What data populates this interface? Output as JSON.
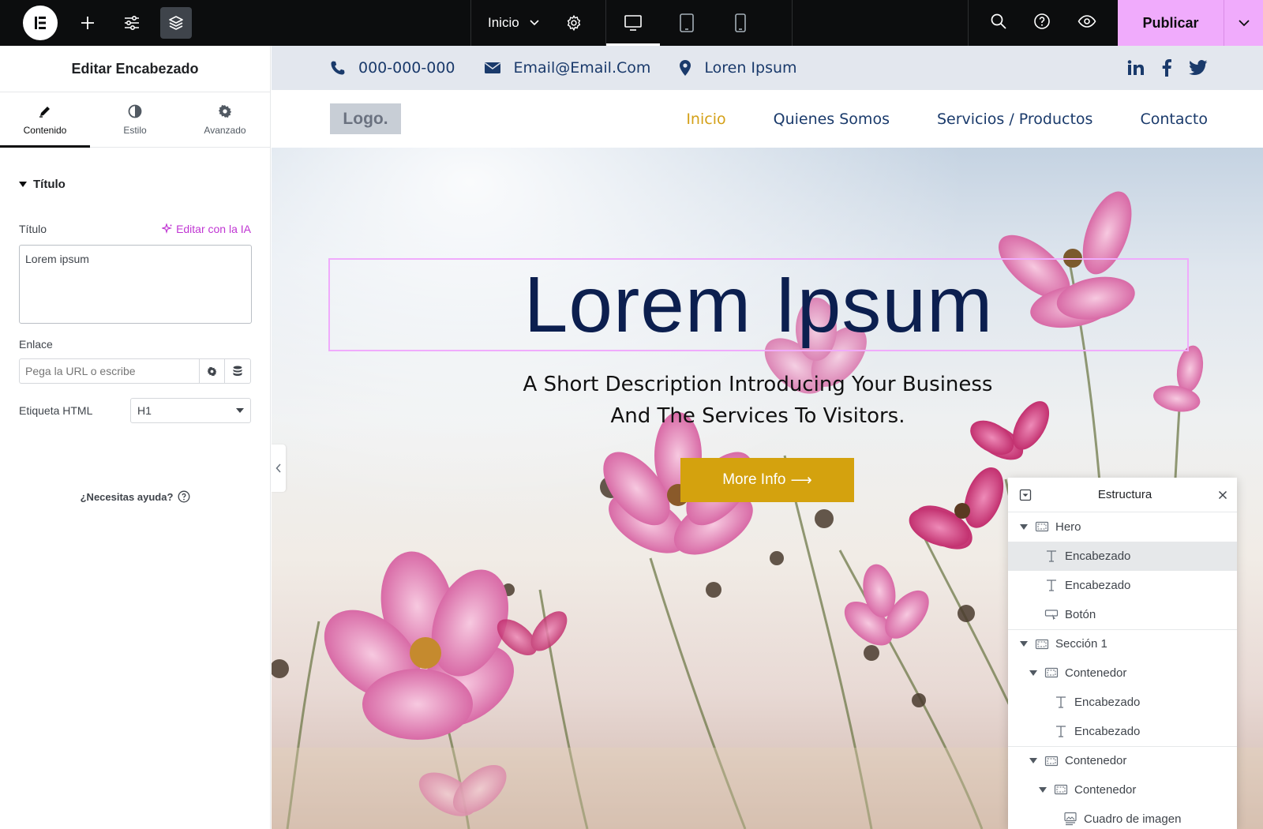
{
  "topbar": {
    "page_label": "Inicio",
    "publish_label": "Publicar"
  },
  "panel": {
    "title": "Editar Encabezado",
    "tabs": [
      {
        "label": "Contenido"
      },
      {
        "label": "Estilo"
      },
      {
        "label": "Avanzado"
      }
    ],
    "section_title": "Título",
    "title_field_label": "Título",
    "ai_link": "Editar con la IA",
    "title_value": "Lorem ipsum",
    "link_label": "Enlace",
    "link_placeholder": "Pega la URL o escribe",
    "html_tag_label": "Etiqueta HTML",
    "html_tag_value": "H1",
    "help_text": "¿Necesitas ayuda?"
  },
  "site": {
    "phone": "000-000-000",
    "email": "Email@Email.Com",
    "location": "Loren Ipsum",
    "logo": "Logo.",
    "nav": [
      {
        "label": "Inicio"
      },
      {
        "label": "Quienes Somos"
      },
      {
        "label": "Servicios / Productos"
      },
      {
        "label": "Contacto"
      }
    ],
    "hero_title": "Lorem Ipsum",
    "hero_desc_line1": "A Short Description Introducing Your Business",
    "hero_desc_line2": "And The Services To Visitors.",
    "cta": "More Info",
    "cta_arrow": "⟶"
  },
  "structure": {
    "title": "Estructura",
    "items": [
      {
        "label": "Hero"
      },
      {
        "label": "Encabezado"
      },
      {
        "label": "Encabezado"
      },
      {
        "label": "Botón"
      },
      {
        "label": "Sección 1"
      },
      {
        "label": "Contenedor"
      },
      {
        "label": "Encabezado"
      },
      {
        "label": "Encabezado"
      },
      {
        "label": "Contenedor"
      },
      {
        "label": "Contenedor"
      },
      {
        "label": "Cuadro de imagen"
      }
    ]
  },
  "colors": {
    "accent": "#f0abfc",
    "cta": "#d4a20e",
    "nav_active": "#d4a017",
    "heading": "#0c1f4f"
  }
}
